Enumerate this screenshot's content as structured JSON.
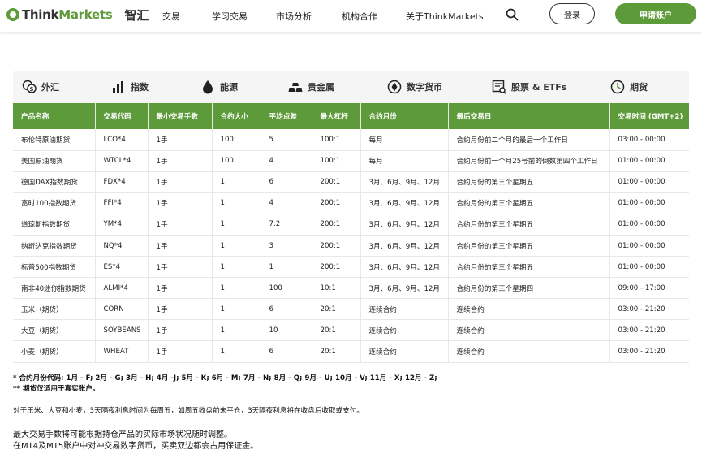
{
  "header": {
    "logo_think": "Think",
    "logo_markets": "Markets",
    "logo_cn": "智汇",
    "nav": [
      "交易",
      "学习交易",
      "市场分析",
      "机构合作",
      "关于ThinkMarkets"
    ],
    "login": "登录",
    "apply": "申请账户"
  },
  "tabs": [
    "外汇",
    "指数",
    "能源",
    "贵金属",
    "数字货币",
    "股票 & ETFs",
    "期货"
  ],
  "table": {
    "headers": [
      "产品名称",
      "交易代码",
      "最小交易手数",
      "合约大小",
      "平均点差",
      "最大杠杆",
      "合约月份",
      "最后交易日",
      "交易时间 (GMT+2)"
    ],
    "rows": [
      [
        "布伦特原油期货",
        "LCO*4",
        "1手",
        "100",
        "5",
        "100:1",
        "每月",
        "合约月份前二个月的最后一个工作日",
        "03:00 - 00:00"
      ],
      [
        "美国原油期货",
        "WTCL*4",
        "1手",
        "100",
        "4",
        "100:1",
        "每月",
        "合约月份前一个月25号前的倒数第四个工作日",
        "01:00 - 00:00"
      ],
      [
        "德国DAX指数期货",
        "FDX*4",
        "1手",
        "1",
        "6",
        "200:1",
        "3月、6月、9月、12月",
        "合约月份的第三个星期五",
        "01:00 - 00:00"
      ],
      [
        "富时100指数期货",
        "FFI*4",
        "1手",
        "1",
        "4",
        "200:1",
        "3月、6月、9月、12月",
        "合约月份的第三个星期五",
        "01:00 - 00:00"
      ],
      [
        "道琼斯指数期货",
        "YM*4",
        "1手",
        "1",
        "7.2",
        "200:1",
        "3月、6月、9月、12月",
        "合约月份的第三个星期五",
        "01:00 - 00:00"
      ],
      [
        "纳斯达克指数期货",
        "NQ*4",
        "1手",
        "1",
        "3",
        "200:1",
        "3月、6月、9月、12月",
        "合约月份的第三个星期五",
        "01:00 - 00:00"
      ],
      [
        "标普500指数期货",
        "ES*4",
        "1手",
        "1",
        "1",
        "200:1",
        "3月、6月、9月、12月",
        "合约月份的第三个星期五",
        "01:00 - 00:00"
      ],
      [
        "南非40迷你指数期货",
        "ALMI*4",
        "1手",
        "1",
        "100",
        "10:1",
        "3月、6月、9月、12月",
        "合约月份的第三个星期四",
        "09:00 - 17:00"
      ],
      [
        "玉米（期货）",
        "CORN",
        "1手",
        "1",
        "6",
        "20:1",
        "连续合约",
        "连续合约",
        "03:00 - 21:20"
      ],
      [
        "大豆（期货）",
        "SOYBEANS",
        "1手",
        "1",
        "10",
        "20:1",
        "连续合约",
        "连续合约",
        "03:00 - 21:20"
      ],
      [
        "小麦（期货）",
        "WHEAT",
        "1手",
        "1",
        "6",
        "20:1",
        "连续合约",
        "连续合约",
        "03:00 - 21:20"
      ]
    ]
  },
  "notes": {
    "codes": "* 合约月份代码: 1月 - F; 2月 - G; 3月 - H; 4月 -J; 5月 - K; 6月 - M; 7月 - N; 8月 - Q; 9月 - U; 10月 - V; 11月 - X; 12月 - Z;",
    "real_only": "** 期货仅适用于真实账户。",
    "rollover": "对于玉米、大豆和小麦，3天隔夜利息时间为每周五，如周五收盘前未平仓，3天隔夜利息将在收盘后收取或支付。",
    "max_lots": "最大交易手数将可能根据持仓产品的实际市场状况随时调整。",
    "crypto": "在MT4及MT5账户中对冲交易数字货币，买卖双边都会占用保证金。"
  },
  "colors": {
    "brand_green": "#5d9a3a"
  }
}
